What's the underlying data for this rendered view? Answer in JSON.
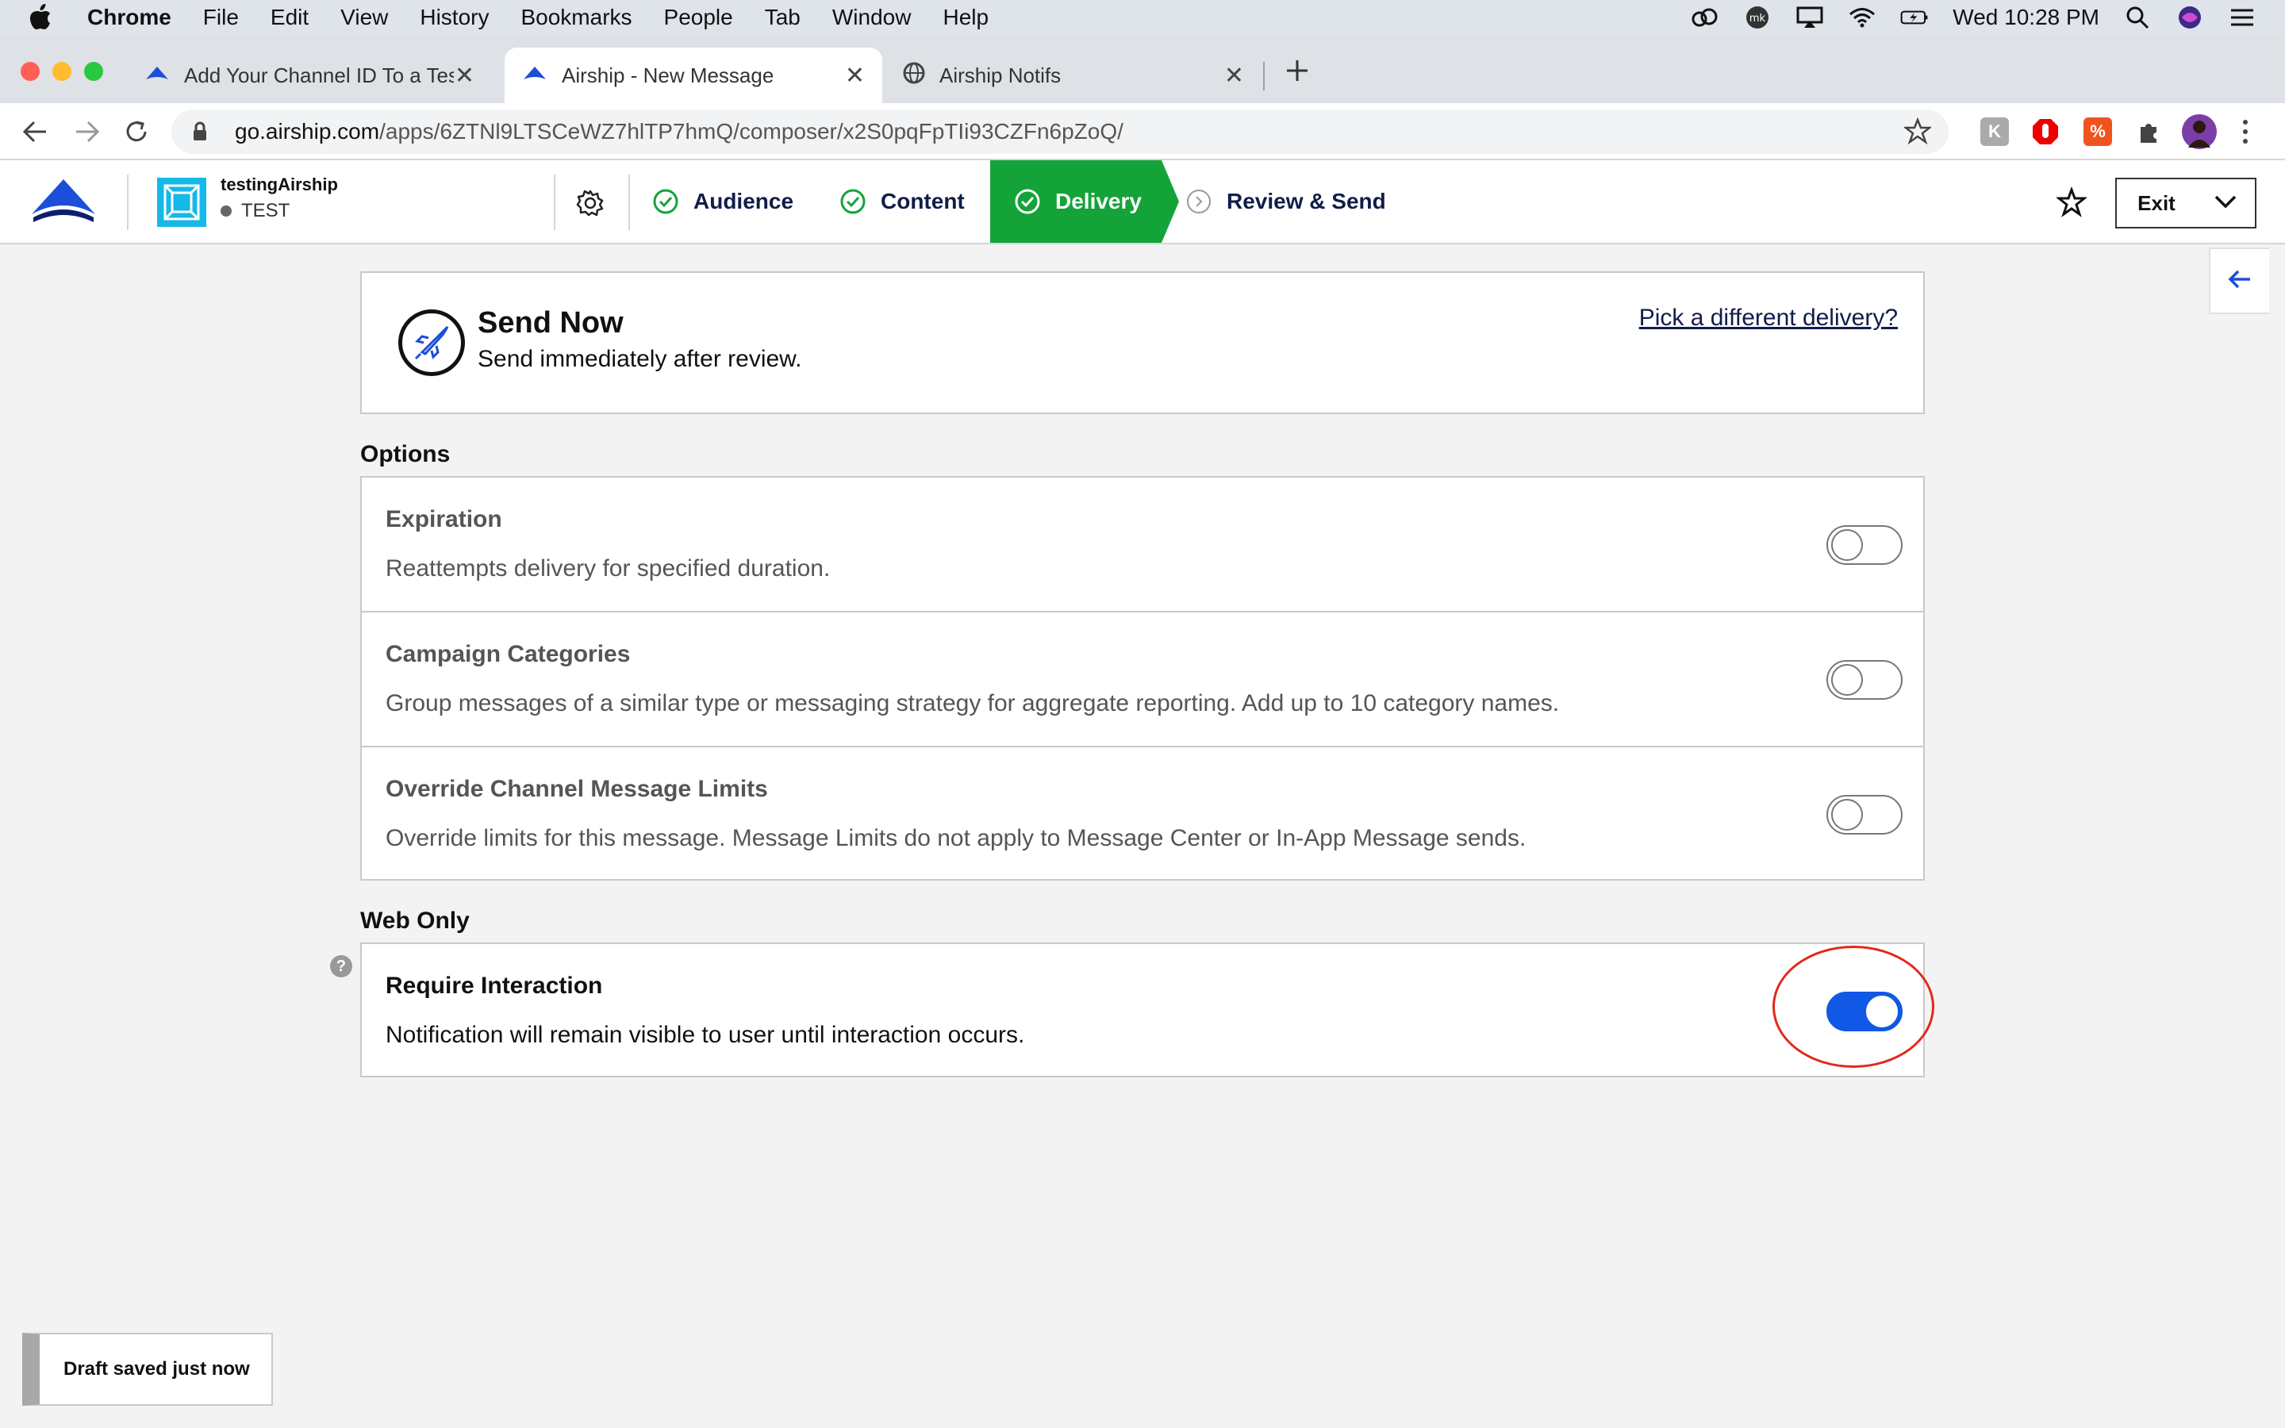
{
  "menubar": {
    "app": "Chrome",
    "items": [
      "File",
      "Edit",
      "View",
      "History",
      "Bookmarks",
      "People",
      "Tab",
      "Window",
      "Help"
    ],
    "clock": "Wed 10:28 PM"
  },
  "tabs": [
    {
      "title": "Add Your Channel ID To a Test",
      "icon": "airship-logo-icon"
    },
    {
      "title": "Airship - New Message",
      "icon": "airship-logo-icon"
    },
    {
      "title": "Airship Notifs",
      "icon": "globe-icon"
    }
  ],
  "address": {
    "host": "go.airship.com",
    "path": "/apps/6ZTNl9LTSCeWZ7hlTP7hmQ/composer/x2S0pqFpTIi93CZFn6pZoQ/"
  },
  "header": {
    "project_name": "testingAirship",
    "project_env": "TEST",
    "steps": [
      "Audience",
      "Content",
      "Delivery",
      "Review & Send"
    ],
    "active_step": "Delivery",
    "exit_label": "Exit"
  },
  "delivery": {
    "title": "Send Now",
    "description": "Send immediately after review.",
    "change_link": "Pick a different delivery?"
  },
  "options": {
    "label": "Options",
    "items": [
      {
        "title": "Expiration",
        "description": "Reattempts delivery for specified duration.",
        "enabled": false
      },
      {
        "title": "Campaign Categories",
        "description": "Group messages of a similar type or messaging strategy for aggregate reporting. Add up to 10 category names.",
        "enabled": false
      },
      {
        "title": "Override Channel Message Limits",
        "description": "Override limits for this message. Message Limits do not apply to Message Center or In-App Message sends.",
        "enabled": false
      }
    ]
  },
  "web_only": {
    "label": "Web Only",
    "items": [
      {
        "title": "Require Interaction",
        "description": "Notification will remain visible to user until interaction occurs.",
        "enabled": true
      }
    ]
  },
  "status": {
    "draft": "Draft saved just now"
  },
  "colors": {
    "accent_green": "#14a339",
    "toggle_on": "#1158e6",
    "brand_navy": "#111d4a",
    "annotation_red": "#e02a1d"
  }
}
